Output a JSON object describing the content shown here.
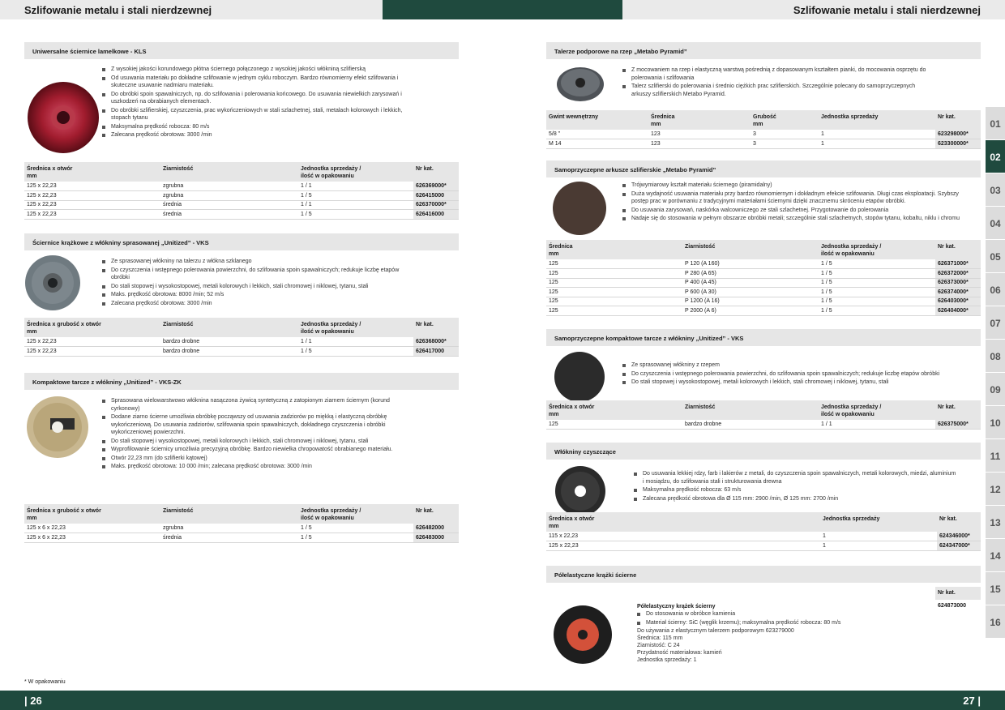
{
  "header": {
    "left_title": "Szlifowanie metalu i stali nierdzewnej",
    "right_title": "Szlifowanie metalu i stali nierdzewnej"
  },
  "footer": {
    "page_left": "| 26",
    "page_right": "27 |",
    "footnote": "* W opakowaniu"
  },
  "tabs": [
    "01",
    "02",
    "03",
    "04",
    "05",
    "06",
    "07",
    "08",
    "09",
    "10",
    "11",
    "12",
    "13",
    "14",
    "15",
    "16"
  ],
  "active_tab": "02",
  "left": {
    "s1": {
      "title": "Uniwersalne ściernice lamelkowe - KLS",
      "bullets": [
        "Z wysokiej jakości korundowego płótna ściernego połączonego z wysokiej jakości włókniną szlifierską",
        "Od usuwania materiału po dokładne szlifowanie w jednym cyklu roboczym. Bardzo równomierny efekt szlifowania i skuteczne usuwanie nadmiaru materiału.",
        "Do obróbki spoin spawalniczych, np. do szlifowania i polerowania końcowego. Do usuwania niewielkich zarysowań i uszkodzeń na obrabianych elementach.",
        "Do obróbki szlifierskiej, czyszczenia, prac wykończeniowych w stali szlachetnej, stali, metalach kolorowych i lekkich, stopach tytanu",
        "Maksymalna prędkość robocza: 80 m/s",
        "Zalecana prędkość obrotowa: 3000 /min"
      ],
      "headers": [
        "Średnica x otwór\nmm",
        "Ziarnistość",
        "Jednostka sprzedaży /\nilość w opakowaniu",
        "Nr kat."
      ],
      "rows": [
        [
          "125 x 22,23",
          "zgrubna",
          "1 / 1",
          "626369000*"
        ],
        [
          "125 x 22,23",
          "zgrubna",
          "1 / 5",
          "626415000"
        ],
        [
          "125 x 22,23",
          "średnia",
          "1 / 1",
          "626370000*"
        ],
        [
          "125 x 22,23",
          "średnia",
          "1 / 5",
          "626416000"
        ]
      ]
    },
    "s2": {
      "title": "Ściernice krążkowe z włókniny sprasowanej „Unitized” - VKS",
      "bullets": [
        "Ze sprasowanej włókniny na talerzu z włókna szklanego",
        "Do czyszczenia i wstępnego polerowania powierzchni, do szlifowania spoin spawalniczych; redukuje liczbę etapów obróbki",
        "Do stali stopowej i wysokostopowej, metali kolorowych i lekkich, stali chromowej i niklowej, tytanu, stali",
        "Maks. prędkość obrotowa: 8000 /min; 52 m/s",
        "Zalecana prędkość obrotowa: 3000 /min"
      ],
      "headers": [
        "Średnica x grubość x otwór\nmm",
        "Ziarnistość",
        "Jednostka sprzedaży /\nilość w opakowaniu",
        "Nr kat."
      ],
      "rows": [
        [
          "125 x 22,23",
          "bardzo drobne",
          "1 / 1",
          "626368000*"
        ],
        [
          "125 x 22,23",
          "bardzo drobne",
          "1 / 5",
          "626417000"
        ]
      ]
    },
    "s3": {
      "title": "Kompaktowe tarcze z włókniny „Unitized” - VKS-ZK",
      "bullets": [
        "Sprasowana wielowarstwowo włóknina nasączona żywicą syntetyczną z zatopionym ziarnem ściernym (korund cyrkonowy)",
        "Dodane ziarno ścierne umożliwia obróbkę począwszy od usuwania zadziorów po miękką i elastyczną obróbkę wykończeniową. Do usuwania zadziorów, szlifowania spoin spawalniczych, dokładnego czyszczenia i obróbki wykończeniowej powierzchni.",
        "Do stali stopowej i wysokostopowej, metali kolorowych i lekkich, stali chromowej i niklowej, tytanu, stali",
        "Wyprofilowanie ściernicy umożliwia precyzyjną obróbkę. Bardzo niewielka chropowatość obrabianego materiału.",
        "Otwór 22,23 mm (do szlifierki kątowej)",
        "Maks. prędkość obrotowa: 10 000 /min; zalecana prędkość obrotowa: 3000 /min"
      ],
      "headers": [
        "Średnica x grubość x otwór\nmm",
        "Ziarnistość",
        "Jednostka sprzedaży /\nilość w opakowaniu",
        "Nr kat."
      ],
      "rows": [
        [
          "125 x 6 x 22,23",
          "zgrubna",
          "1 / 5",
          "626482000"
        ],
        [
          "125 x 6 x 22,23",
          "średnia",
          "1 / 5",
          "626483000"
        ]
      ]
    }
  },
  "right": {
    "s1": {
      "title": "Talerze podporowe na rzep „Metabo Pyramid”",
      "bullets": [
        "Z mocowaniem na rzep i elastyczną warstwą pośrednią z dopasowanym kształtem pianki, do mocowania osprzętu do polerowania i szlifowania",
        "Talerz szlifierski do polerowania i średnio ciężkich prac szlifierskich. Szczególnie polecany do samoprzyczepnych arkuszy szlifierskich Metabo Pyramid."
      ],
      "headers": [
        "Gwint wewnętrzny",
        "Średnica\nmm",
        "Grubość\nmm",
        "Jednostka sprzedaży",
        "Nr kat."
      ],
      "rows": [
        [
          "5/8 \"",
          "123",
          "3",
          "1",
          "623298000*"
        ],
        [
          "M 14",
          "123",
          "3",
          "1",
          "623300000*"
        ]
      ]
    },
    "s2": {
      "title": "Samoprzyczepne arkusze szlifierskie „Metabo Pyramid”",
      "bullets": [
        "Trójwymiarowy kształt materiału ściernego (piramidalny)",
        "Duża wydajność usuwania materiału przy bardzo równomiernym i dokładnym efekcie szlifowania. Długi czas eksploatacji. Szybszy postęp prac w porównaniu z tradycyjnymi materiałami ściernymi dzięki znacznemu skróceniu etapów obróbki.",
        "Do usuwania zarysowań, naskórka walcowniczego ze stali szlachetnej. Przygotowanie do polerowania",
        "Nadaje się do stosowania w pełnym obszarze obróbki metali; szczególnie stali szlachetnych, stopów tytanu, kobaltu, niklu i chromu"
      ],
      "headers": [
        "Średnica\nmm",
        "Ziarnistość",
        "Jednostka sprzedaży /\nilość w opakowaniu",
        "Nr kat."
      ],
      "rows": [
        [
          "125",
          "P 120 (A 160)",
          "1 / 5",
          "626371000*"
        ],
        [
          "125",
          "P 280 (A 65)",
          "1 / 5",
          "626372000*"
        ],
        [
          "125",
          "P 400 (A 45)",
          "1 / 5",
          "626373000*"
        ],
        [
          "125",
          "P 600 (A 30)",
          "1 / 5",
          "626374000*"
        ],
        [
          "125",
          "P 1200 (A 16)",
          "1 / 5",
          "626403000*"
        ],
        [
          "125",
          "P 2000 (A 6)",
          "1 / 5",
          "626404000*"
        ]
      ]
    },
    "s3": {
      "title": "Samoprzyczepne kompaktowe tarcze z włókniny „Unitized” - VKS",
      "bullets": [
        "Ze sprasowanej włókniny z rzepem",
        "Do czyszczenia i wstępnego polerowania powierzchni, do szlifowania spoin spawalniczych; redukuje liczbę etapów obróbki",
        "Do stali stopowej i wysokostopowej, metali kolorowych i lekkich, stali chromowej i niklowej, tytanu, stali"
      ],
      "headers": [
        "Średnica x otwór\nmm",
        "Ziarnistość",
        "Jednostka sprzedaży /\nilość w opakowaniu",
        "Nr kat."
      ],
      "rows": [
        [
          "125",
          "bardzo drobne",
          "1 / 1",
          "626375000*"
        ]
      ]
    },
    "s4": {
      "title": "Włókniny czyszczące",
      "bullets": [
        "Do usuwania lekkiej rdzy, farb i lakierów z metali, do czyszczenia spoin spawalniczych, metali kolorowych, miedzi, aluminium i mosiądzu, do szlifowania stali i strukturowania drewna",
        "Maksymalna prędkość robocza: 63 m/s",
        "Zalecana prędkość obrotowa dla Ø 115 mm: 2900 /min, Ø 125 mm: 2700 /min"
      ],
      "headers": [
        "Średnica x otwór\nmm",
        "Jednostka sprzedaży",
        "Nr kat."
      ],
      "rows": [
        [
          "115 x 22,23",
          "1",
          "624346000*"
        ],
        [
          "125 x 22,23",
          "1",
          "624347000*"
        ]
      ]
    },
    "s5": {
      "title": "Półelastyczne krążki ścierne",
      "nr_header": "Nr kat.",
      "product_name": "Półelastyczny krążek ścierny",
      "bullets": [
        "Do stosowania w obróbce kamienia",
        "Materiał ścierny: SiC (węglik krzemu); maksymalna prędkość robocza: 80 m/s"
      ],
      "lines": [
        "Do używania z elastycznym talerzem podporowym 623279000",
        "Średnica: 115 mm",
        "Ziarnistość: C 24",
        "Przydatność materiałowa: kamień",
        "Jednostka sprzedaży: 1"
      ],
      "nr": "624873000"
    }
  }
}
